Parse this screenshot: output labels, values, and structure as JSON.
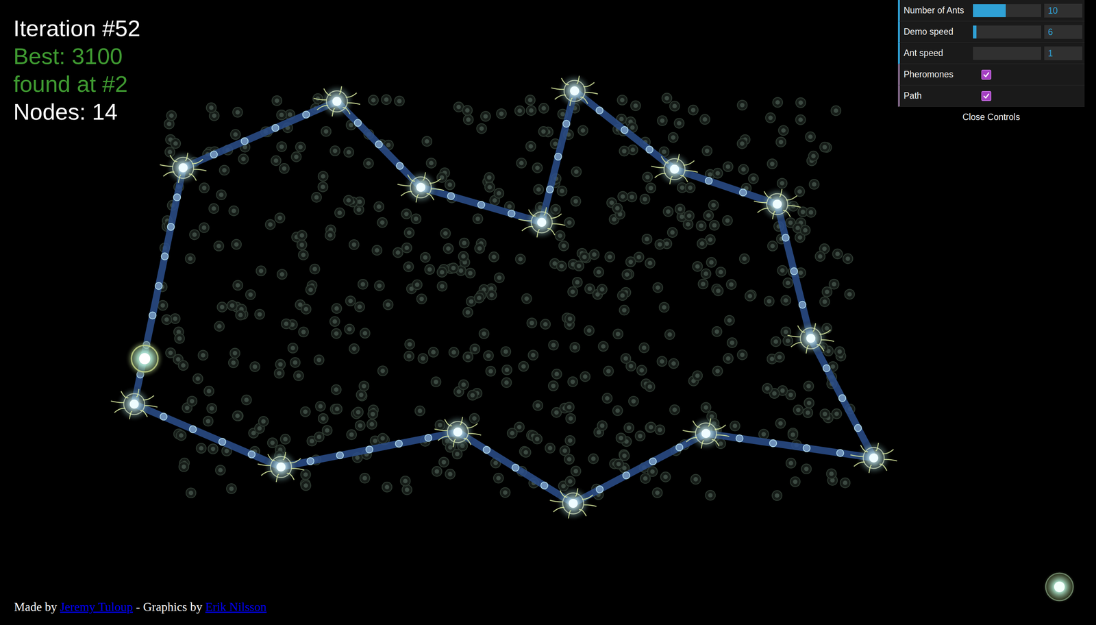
{
  "stats": {
    "iteration": "Iteration #52",
    "best": "Best: 3100",
    "found_at": "found at #2",
    "nodes": "Nodes: 14"
  },
  "controls": {
    "rows": [
      {
        "kind": "slider",
        "label": "Number of Ants",
        "level": 0.48,
        "value": "10"
      },
      {
        "kind": "slider",
        "label": "Demo speed",
        "level": 0.05,
        "value": "6"
      },
      {
        "kind": "slider",
        "label": "Ant speed",
        "level": 0.0,
        "value": "1"
      },
      {
        "kind": "checkbox",
        "label": "Pheromones",
        "checked": true
      },
      {
        "kind": "checkbox",
        "label": "Path",
        "checked": true
      }
    ],
    "close": "Close Controls"
  },
  "footer": {
    "made_by": "Made by",
    "author": "Jeremy Tuloup",
    "separator": "- Graphics by",
    "artist": "Erik Nilsson"
  }
}
